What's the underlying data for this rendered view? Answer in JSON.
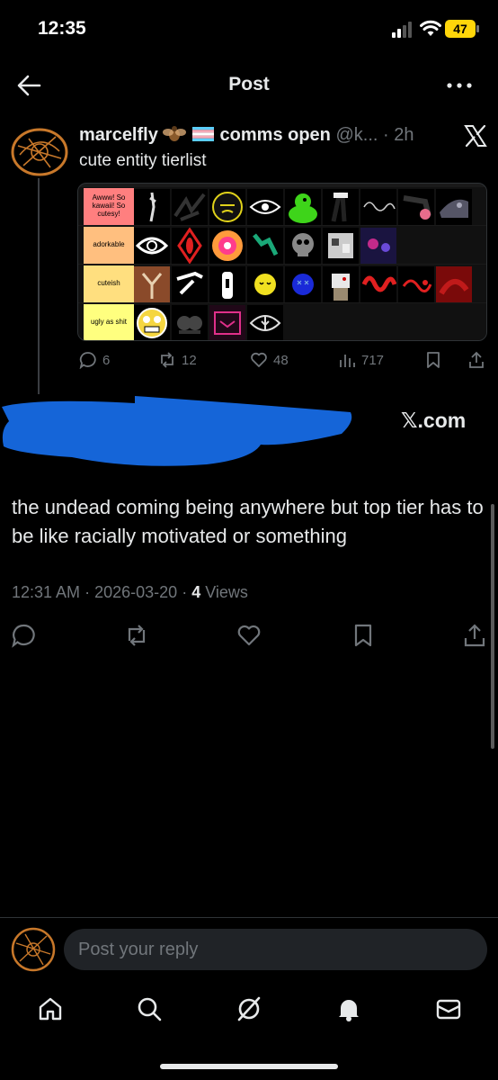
{
  "status_bar": {
    "time": "12:35",
    "battery": "47",
    "battery_color": "#ffd60a"
  },
  "header": {
    "title": "Post",
    "back_icon": "arrow-left-icon",
    "more_icon": "more-horizontal-icon"
  },
  "quoted_post": {
    "author_name": "marcelfly",
    "author_emojis": [
      "fly-emoji",
      "transgender-flag-emoji"
    ],
    "author_suffix": "comms open",
    "handle": "@k...",
    "separator": "·",
    "time": "2h",
    "text": "cute entity tierlist",
    "tiers": [
      {
        "label": "Awww! So kawaii! So cutesy!",
        "color": "#ff7f7f"
      },
      {
        "label": "adorkable",
        "color": "#ffbf7f"
      },
      {
        "label": "cuteish",
        "color": "#ffdf7f"
      },
      {
        "label": "ugly as shit",
        "color": "#ffff7f"
      }
    ],
    "stats": {
      "replies": "6",
      "reposts": "12",
      "likes": "48",
      "views": "717"
    }
  },
  "source_link": "𝕏.com",
  "main_post": {
    "text": "the undead coming being anywhere but top tier has to be like racially motivated or something",
    "time": "12:31 AM",
    "date": "2026-03-20",
    "separator": "·",
    "views_count": "4",
    "views_label": "Views"
  },
  "reply": {
    "placeholder": "Post your reply"
  },
  "tab_bar": {
    "items": [
      "home-icon",
      "search-icon",
      "grok-icon",
      "notifications-icon",
      "messages-icon"
    ]
  },
  "colors": {
    "background": "#000000",
    "text_primary": "#e7e9ea",
    "text_secondary": "#71767b",
    "redaction": "#1565d8"
  }
}
